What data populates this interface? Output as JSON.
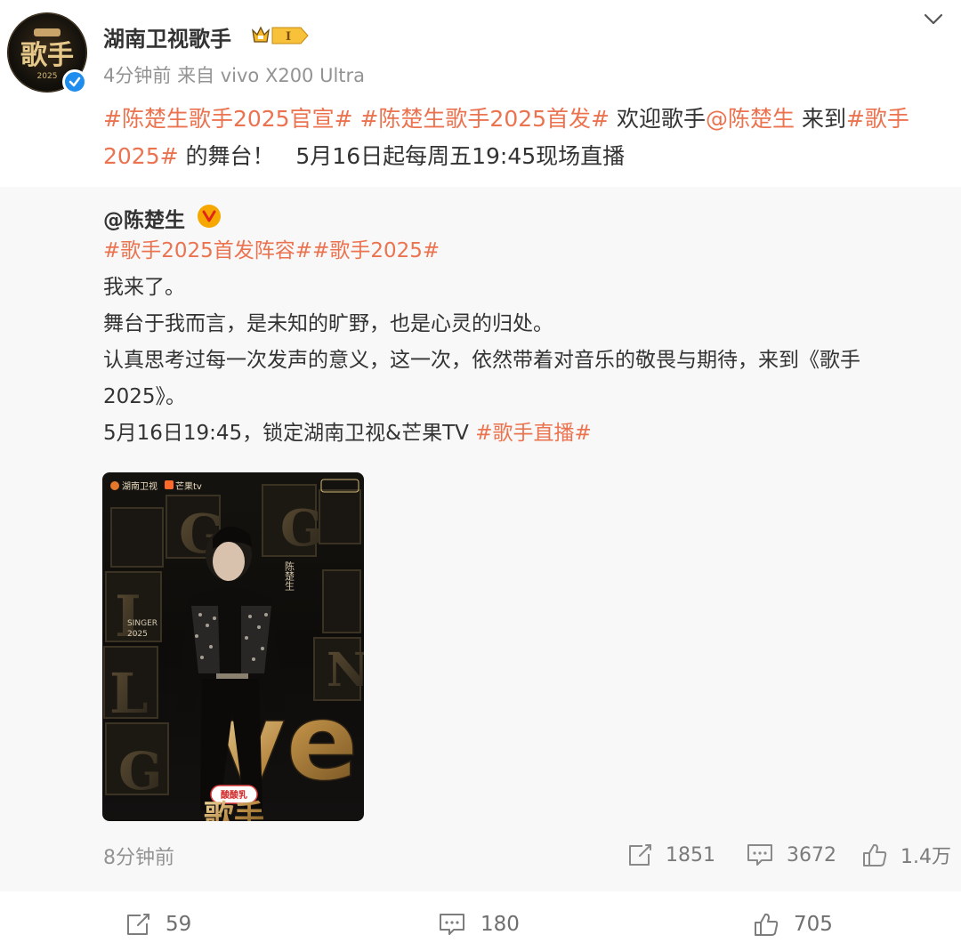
{
  "author": {
    "name": "湖南卫视歌手",
    "member_level": "I",
    "avatar_text": "歌手",
    "avatar_year": "2025"
  },
  "meta": {
    "time": "4分钟前",
    "source": "来自 vivo X200 Ultra"
  },
  "post": {
    "tag1": "#陈楚生歌手2025官宣#",
    "tag2": "#陈楚生歌手2025首发#",
    "text1": "欢迎歌手",
    "mention": "@陈楚生",
    "text2": "来到",
    "tag3": "#歌手2025#",
    "text3": "的舞台！",
    "text4": "5月16日起每周五19:45现场直播"
  },
  "retweet": {
    "author": "@陈楚生",
    "tags_line": "#歌手2025首发阵容##歌手2025#",
    "line1": "我来了。",
    "line2": "舞台于我而言，是未知的旷野，也是心灵的归处。",
    "line3": "认真思考过每一次发声的意义，这一次，依然带着对音乐的敬畏与期待，来到《歌手2025》。",
    "line4_text": "5月16日19:45，锁定湖南卫视&芒果TV",
    "line4_tag": "#歌手直播#",
    "time": "8分钟前",
    "reposts": "1851",
    "comments": "3672",
    "likes": "1.4万",
    "poster": {
      "channel1": "湖南卫视",
      "channel2": "芒果tv",
      "name_vertical": "陈楚生",
      "singer_label": "SINGER",
      "singer_year": "2025",
      "sponsor": "酸酸乳",
      "title_partial": "歌手"
    }
  },
  "bottom": {
    "reposts": "59",
    "comments": "180",
    "likes": "705"
  },
  "colors": {
    "tag": "#eb7350",
    "meta": "#939393",
    "verified": "#1f8ded",
    "v_badge": "#f6a800",
    "retweet_bg": "#f8f8f8"
  }
}
